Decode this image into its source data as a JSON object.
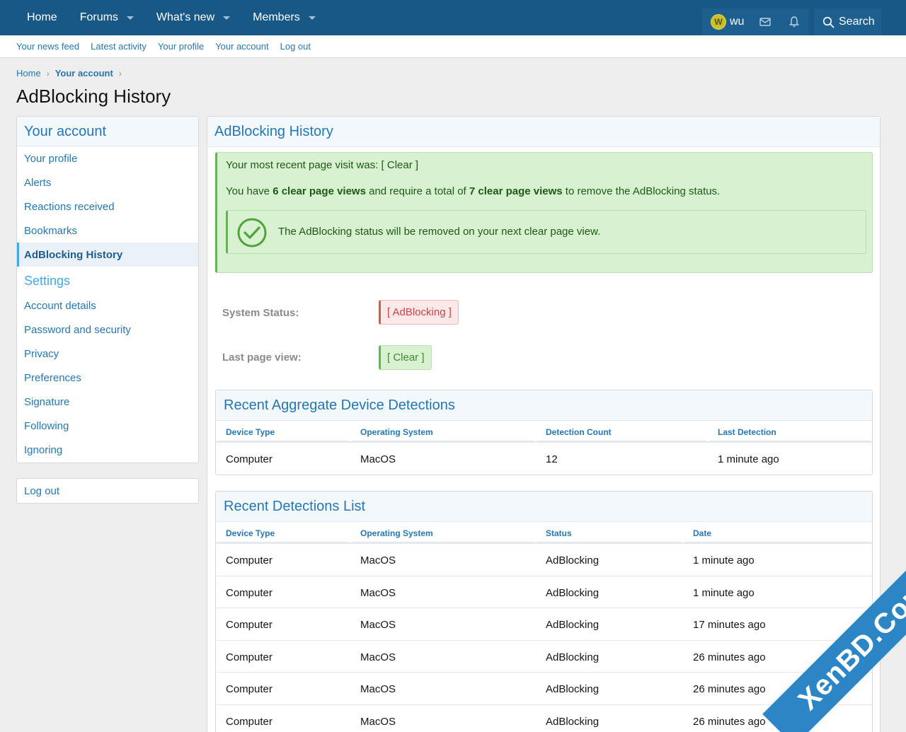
{
  "topnav": {
    "items": [
      {
        "label": "Home",
        "has_menu": false
      },
      {
        "label": "Forums",
        "has_menu": true
      },
      {
        "label": "What's new",
        "has_menu": true
      },
      {
        "label": "Members",
        "has_menu": true
      }
    ],
    "user": {
      "avatar_letter": "W",
      "name": "wu"
    },
    "search_label": "Search"
  },
  "subnav": {
    "items": [
      "Your news feed",
      "Latest activity",
      "Your profile",
      "Your account",
      "Log out"
    ]
  },
  "breadcrumb": {
    "items": [
      "Home",
      "Your account"
    ]
  },
  "page": {
    "title": "AdBlocking History"
  },
  "sidebar": {
    "heading": "Your account",
    "items": [
      "Your profile",
      "Alerts",
      "Reactions received",
      "Bookmarks",
      "AdBlocking History"
    ],
    "active": "AdBlocking History",
    "settings_heading": "Settings",
    "settings_items": [
      "Account details",
      "Password and security",
      "Privacy",
      "Preferences",
      "Signature",
      "Following",
      "Ignoring"
    ],
    "logout": "Log out"
  },
  "main": {
    "heading": "AdBlocking History",
    "notice": {
      "line1": "Your most recent page visit was: [ Clear ]",
      "line2_a": "You have ",
      "line2_b": "6 clear page views",
      "line2_c": " and require a total of ",
      "line2_d": "7 clear page views",
      "line2_e": " to remove the AdBlocking status.",
      "inner_message": "The AdBlocking status will be removed on your next clear page view."
    },
    "system_status_label": "System Status:",
    "system_status_value": "[ AdBlocking ]",
    "last_view_label": "Last page view:",
    "last_view_value": "[ Clear ]"
  },
  "aggregate": {
    "heading": "Recent Aggregate Device Detections",
    "columns": [
      "Device Type",
      "Operating System",
      "Detection Count",
      "Last Detection"
    ],
    "rows": [
      [
        "Computer",
        "MacOS",
        "12",
        "1 minute ago"
      ]
    ]
  },
  "recent": {
    "heading": "Recent Detections List",
    "columns": [
      "Device Type",
      "Operating System",
      "Status",
      "Date"
    ],
    "rows": [
      [
        "Computer",
        "MacOS",
        "AdBlocking",
        "1 minute ago"
      ],
      [
        "Computer",
        "MacOS",
        "AdBlocking",
        "1 minute ago"
      ],
      [
        "Computer",
        "MacOS",
        "AdBlocking",
        "17 minutes ago"
      ],
      [
        "Computer",
        "MacOS",
        "AdBlocking",
        "26 minutes ago"
      ],
      [
        "Computer",
        "MacOS",
        "AdBlocking",
        "26 minutes ago"
      ],
      [
        "Computer",
        "MacOS",
        "AdBlocking",
        "26 minutes ago"
      ]
    ]
  },
  "watermark": "XenBD.Com",
  "colors": {
    "header": "#185886",
    "link": "#2577b1",
    "success": "#63b452",
    "danger": "#d05a5e"
  }
}
